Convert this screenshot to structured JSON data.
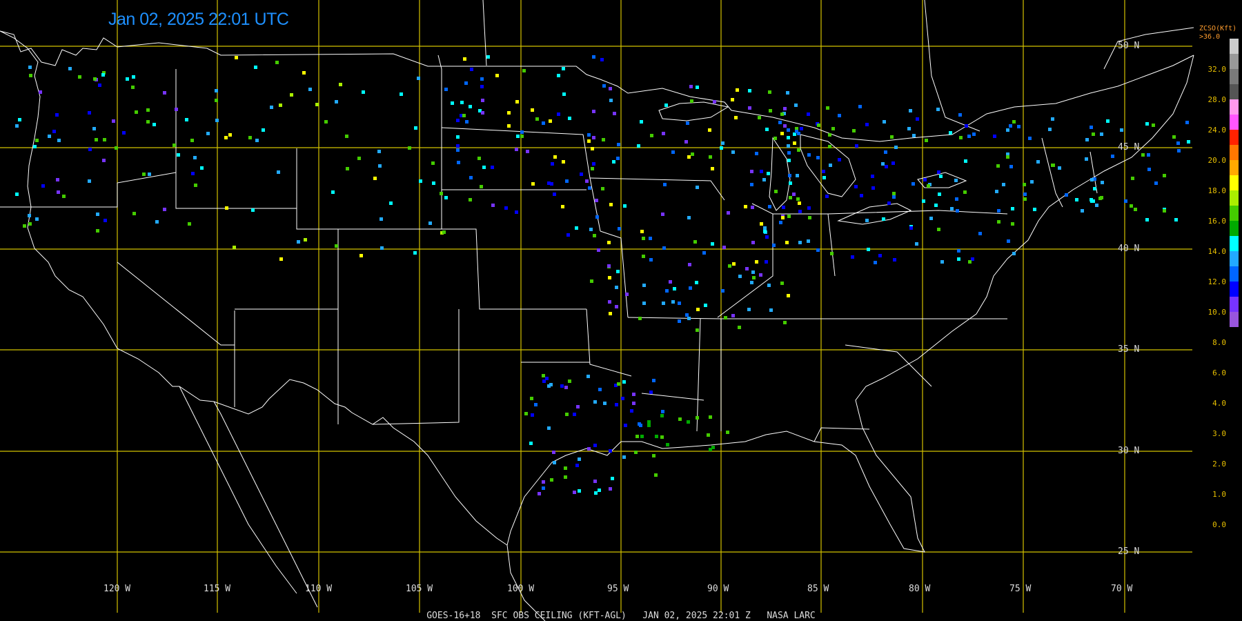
{
  "title": {
    "timestamp": "Jan 02, 2025 22:01 UTC"
  },
  "footer": {
    "text": "GOES-16+18  SFC OBS CEILING (KFT-AGL)   JAN 02, 2025 22:01 Z   NASA LARC"
  },
  "lat_labels": [
    "50 N",
    "45 N",
    "40 N",
    "35 N",
    "30 N",
    "25 N"
  ],
  "lon_labels": [
    "120 W",
    "115 W",
    "110 W",
    "105 W",
    "100 W",
    "95 W",
    "90 W",
    "85 W",
    "80 W",
    "75 W",
    "70 W"
  ],
  "legend": {
    "title_line1": "ZCSO(Kft)",
    "title_line2": ">36.0",
    "labels": [
      "32.0",
      "28.0",
      "24.0",
      "20.0",
      "18.0",
      "16.0",
      "14.0",
      "12.0",
      "10.0",
      "8.0",
      "6.0",
      "4.0",
      "3.0",
      "2.0",
      "1.0",
      "0.0"
    ],
    "colors": [
      "#cccccc",
      "#999999",
      "#7a7a7a",
      "#555555",
      "#ff99ee",
      "#ff55ff",
      "#ff2200",
      "#ff7700",
      "#ffaa00",
      "#ffff00",
      "#aaee00",
      "#44cc00",
      "#00aa00",
      "#00ffff",
      "#22aaff",
      "#0066ff",
      "#0000ff",
      "#7733ff",
      "#9955dd"
    ]
  },
  "colors": {
    "grid": "#d4c200",
    "borders": "#ffffff",
    "timestamp": "#1e90ff"
  }
}
